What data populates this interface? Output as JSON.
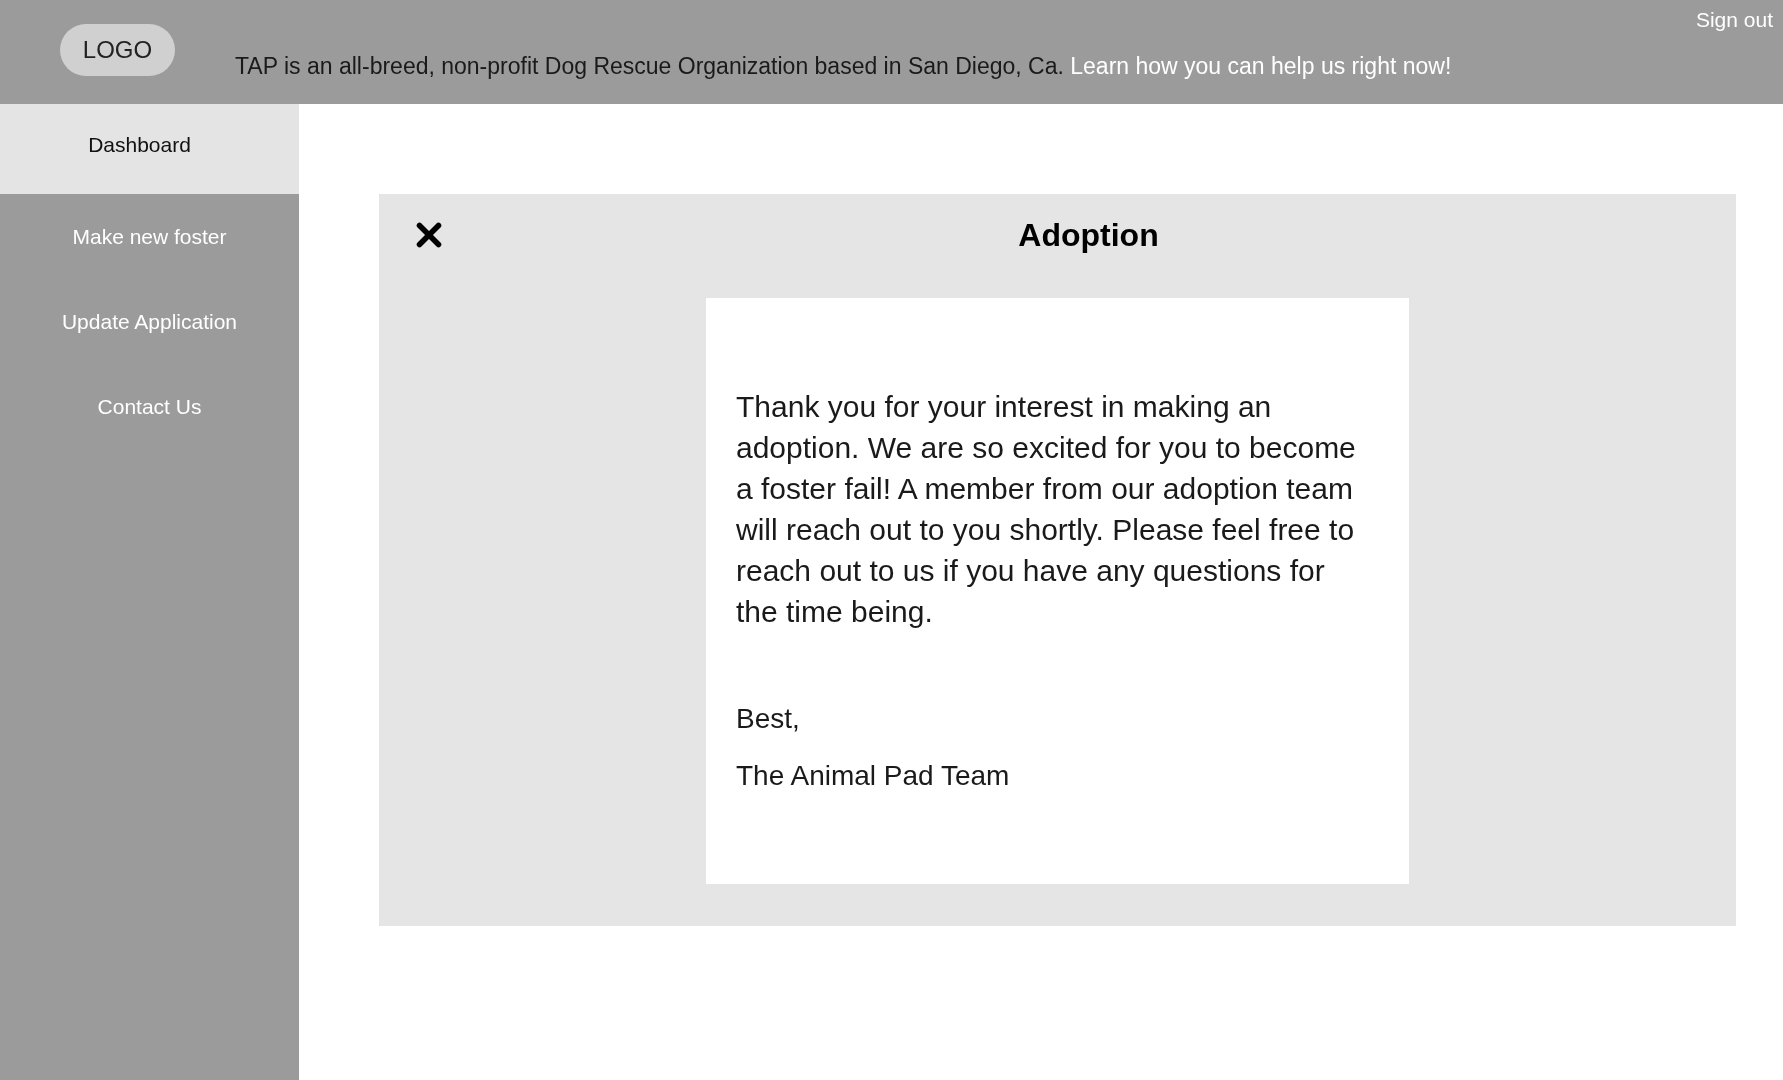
{
  "header": {
    "logo": "LOGO",
    "tagline": "TAP is an all-breed, non-profit Dog Rescue Organization based in San Diego, Ca.",
    "tagline_link": "Learn how you can help us right now!",
    "sign_out": "Sign out"
  },
  "sidebar": {
    "items": [
      {
        "label": "Dashboard",
        "selected": true
      },
      {
        "label": "Make new foster",
        "selected": false
      },
      {
        "label": "Update Application",
        "selected": false
      },
      {
        "label": "Contact Us",
        "selected": false
      }
    ]
  },
  "modal": {
    "title": "Adoption",
    "message": "Thank you for your interest in making an adoption. We are so excited for you to become a foster fail! A member from our adoption team will reach out to you shortly. Please feel free to reach out to us if you have any questions for the time being.",
    "closing": "Best,",
    "signature": "The Animal Pad Team"
  }
}
